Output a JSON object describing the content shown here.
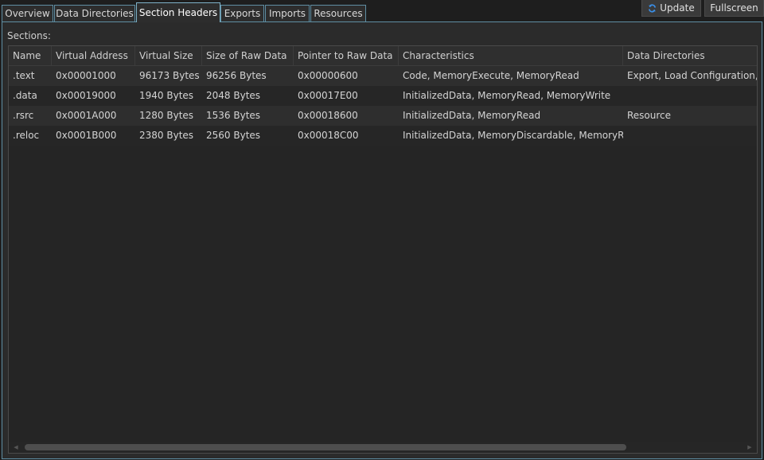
{
  "tabs": [
    {
      "label": "Overview",
      "active": false
    },
    {
      "label": "Data Directories",
      "active": false
    },
    {
      "label": "Section Headers",
      "active": true
    },
    {
      "label": "Exports",
      "active": false
    },
    {
      "label": "Imports",
      "active": false
    },
    {
      "label": "Resources",
      "active": false
    }
  ],
  "actions": {
    "update_label": "Update",
    "update_icon": "refresh-icon",
    "fullscreen_label": "Fullscreen"
  },
  "sections_label": "Sections:",
  "table": {
    "columns": [
      "Name",
      "Virtual Address",
      "Virtual Size",
      "Size of Raw Data",
      "Pointer to Raw Data",
      "Characteristics",
      "Data Directories"
    ],
    "rows": [
      [
        ".text",
        "0x00001000",
        "96173 Bytes",
        "96256 Bytes",
        "0x00000600",
        "Code, MemoryExecute, MemoryRead",
        "Export, Load Configuration, De"
      ],
      [
        ".data",
        "0x00019000",
        "1940 Bytes",
        "2048 Bytes",
        "0x00017E00",
        "InitializedData, MemoryRead, MemoryWrite",
        ""
      ],
      [
        ".rsrc",
        "0x0001A000",
        "1280 Bytes",
        "1536 Bytes",
        "0x00018600",
        "InitializedData, MemoryRead",
        "Resource"
      ],
      [
        ".reloc",
        "0x0001B000",
        "2380 Bytes",
        "2560 Bytes",
        "0x00018C00",
        "InitializedData, MemoryDiscardable, MemoryRead",
        ""
      ]
    ]
  },
  "colors": {
    "accent": "#5f8ea3",
    "background": "#1e1e1e",
    "panel": "#2b2b2b"
  }
}
